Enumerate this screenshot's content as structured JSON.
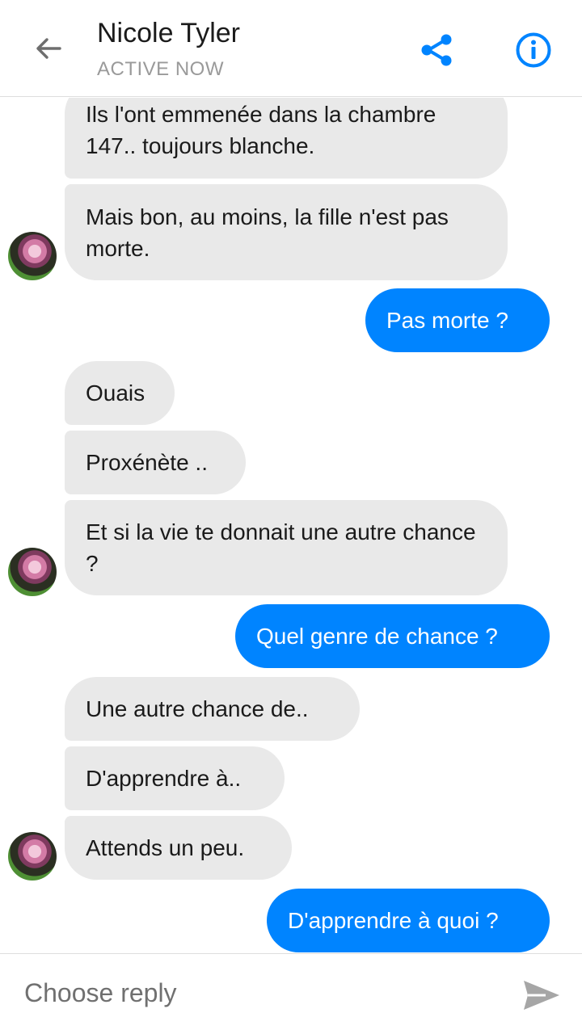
{
  "header": {
    "title": "Nicole Tyler",
    "status": "ACTIVE NOW",
    "back_icon": "arrow-left-icon",
    "share_icon": "share-icon",
    "info_icon": "info-icon",
    "accent_color": "#0084ff"
  },
  "messages": [
    {
      "sender": "contact",
      "text": "Ils l'ont emmenée dans la chambre 147.. toujours blanche."
    },
    {
      "sender": "contact",
      "text": "Mais bon, au moins, la fille n'est pas morte."
    },
    {
      "sender": "me",
      "text": "Pas morte ?"
    },
    {
      "sender": "contact",
      "text": "Ouais"
    },
    {
      "sender": "contact",
      "text": "Proxénète .."
    },
    {
      "sender": "contact",
      "text": "Et si la vie te donnait une autre chance ?"
    },
    {
      "sender": "me",
      "text": "Quel genre de chance ?"
    },
    {
      "sender": "contact",
      "text": "Une autre chance de.."
    },
    {
      "sender": "contact",
      "text": "D'apprendre à.."
    },
    {
      "sender": "contact",
      "text": "Attends un peu."
    },
    {
      "sender": "me",
      "text": "D'apprendre à quoi ?"
    }
  ],
  "composer": {
    "placeholder": "Choose reply",
    "send_icon": "send-icon"
  },
  "colors": {
    "outgoing_bubble": "#0084ff",
    "incoming_bubble": "#e9e9e9"
  }
}
